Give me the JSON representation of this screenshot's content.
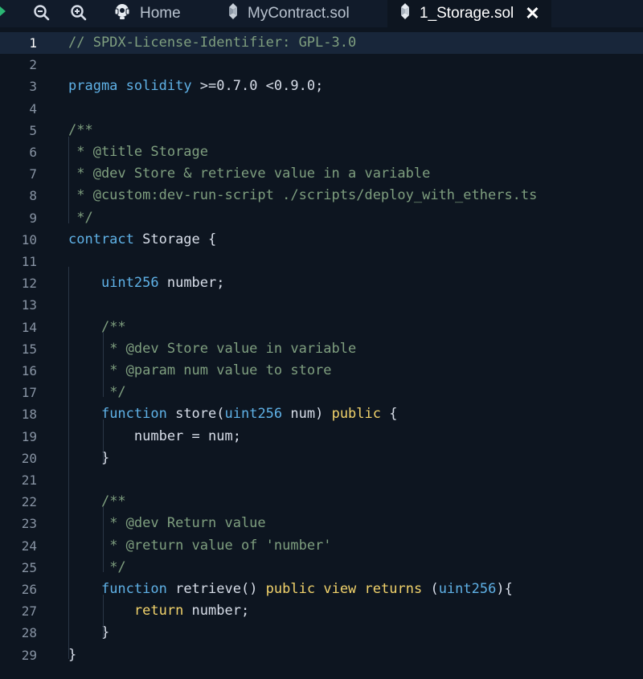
{
  "colors": {
    "background": "#0d1520",
    "tabbar": "#111b2a",
    "current_line": "#18263a",
    "comment": "#7f9f7f",
    "keyword": "#5fb1e6",
    "modifier": "#f2d36b",
    "text": "#d8dee9"
  },
  "toolbar": {
    "zoom_out_icon": "zoom-out-icon",
    "zoom_in_icon": "zoom-in-icon"
  },
  "tabs": [
    {
      "label": "Home",
      "icon": "home-icon",
      "active": false
    },
    {
      "label": "MyContract.sol",
      "icon": "solidity-icon",
      "active": false
    },
    {
      "label": "1_Storage.sol",
      "icon": "solidity-icon",
      "active": true,
      "close": "✕"
    }
  ],
  "editor": {
    "current_line": 1,
    "lines": [
      {
        "n": "1",
        "tokens": [
          [
            "c",
            "// SPDX-License-Identifier: GPL-3.0"
          ]
        ]
      },
      {
        "n": "2",
        "tokens": []
      },
      {
        "n": "3",
        "tokens": [
          [
            "k",
            "pragma"
          ],
          [
            "p",
            " "
          ],
          [
            "k",
            "solidity"
          ],
          [
            "p",
            " >=0.7.0 <0.9.0;"
          ]
        ]
      },
      {
        "n": "4",
        "tokens": []
      },
      {
        "n": "5",
        "tokens": [
          [
            "c",
            "/**"
          ]
        ]
      },
      {
        "n": "6",
        "tokens": [
          [
            "c",
            " * @title Storage"
          ]
        ]
      },
      {
        "n": "7",
        "tokens": [
          [
            "c",
            " * @dev Store & retrieve value in a variable"
          ]
        ]
      },
      {
        "n": "8",
        "tokens": [
          [
            "c",
            " * @custom:dev-run-script ./scripts/deploy_with_ethers.ts"
          ]
        ]
      },
      {
        "n": "9",
        "tokens": [
          [
            "c",
            " */"
          ]
        ]
      },
      {
        "n": "10",
        "tokens": [
          [
            "k",
            "contract"
          ],
          [
            "p",
            " Storage {"
          ]
        ]
      },
      {
        "n": "11",
        "tokens": []
      },
      {
        "n": "12",
        "tokens": [
          [
            "p",
            "    "
          ],
          [
            "k",
            "uint256"
          ],
          [
            "p",
            " number;"
          ]
        ]
      },
      {
        "n": "13",
        "tokens": []
      },
      {
        "n": "14",
        "tokens": [
          [
            "p",
            "    "
          ],
          [
            "c",
            "/**"
          ]
        ]
      },
      {
        "n": "15",
        "tokens": [
          [
            "p",
            "    "
          ],
          [
            "c",
            " * @dev Store value in variable"
          ]
        ]
      },
      {
        "n": "16",
        "tokens": [
          [
            "p",
            "    "
          ],
          [
            "c",
            " * @param num value to store"
          ]
        ]
      },
      {
        "n": "17",
        "tokens": [
          [
            "p",
            "    "
          ],
          [
            "c",
            " */"
          ]
        ]
      },
      {
        "n": "18",
        "tokens": [
          [
            "p",
            "    "
          ],
          [
            "k",
            "function"
          ],
          [
            "p",
            " store("
          ],
          [
            "k",
            "uint256"
          ],
          [
            "p",
            " num) "
          ],
          [
            "m",
            "public"
          ],
          [
            "p",
            " {"
          ]
        ]
      },
      {
        "n": "19",
        "tokens": [
          [
            "p",
            "        number = num;"
          ]
        ]
      },
      {
        "n": "20",
        "tokens": [
          [
            "p",
            "    }"
          ]
        ]
      },
      {
        "n": "21",
        "tokens": []
      },
      {
        "n": "22",
        "tokens": [
          [
            "p",
            "    "
          ],
          [
            "c",
            "/**"
          ]
        ]
      },
      {
        "n": "23",
        "tokens": [
          [
            "p",
            "    "
          ],
          [
            "c",
            " * @dev Return value"
          ]
        ]
      },
      {
        "n": "24",
        "tokens": [
          [
            "p",
            "    "
          ],
          [
            "c",
            " * @return value of 'number'"
          ]
        ]
      },
      {
        "n": "25",
        "tokens": [
          [
            "p",
            "    "
          ],
          [
            "c",
            " */"
          ]
        ]
      },
      {
        "n": "26",
        "tokens": [
          [
            "p",
            "    "
          ],
          [
            "k",
            "function"
          ],
          [
            "p",
            " retrieve() "
          ],
          [
            "m",
            "public"
          ],
          [
            "p",
            " "
          ],
          [
            "m",
            "view"
          ],
          [
            "p",
            " "
          ],
          [
            "m",
            "returns"
          ],
          [
            "p",
            " ("
          ],
          [
            "k",
            "uint256"
          ],
          [
            "p",
            "){"
          ]
        ]
      },
      {
        "n": "27",
        "tokens": [
          [
            "p",
            "        "
          ],
          [
            "m",
            "return"
          ],
          [
            "p",
            " number;"
          ]
        ]
      },
      {
        "n": "28",
        "tokens": [
          [
            "p",
            "    }"
          ]
        ]
      },
      {
        "n": "29",
        "tokens": [
          [
            "p",
            "}"
          ]
        ]
      }
    ]
  }
}
